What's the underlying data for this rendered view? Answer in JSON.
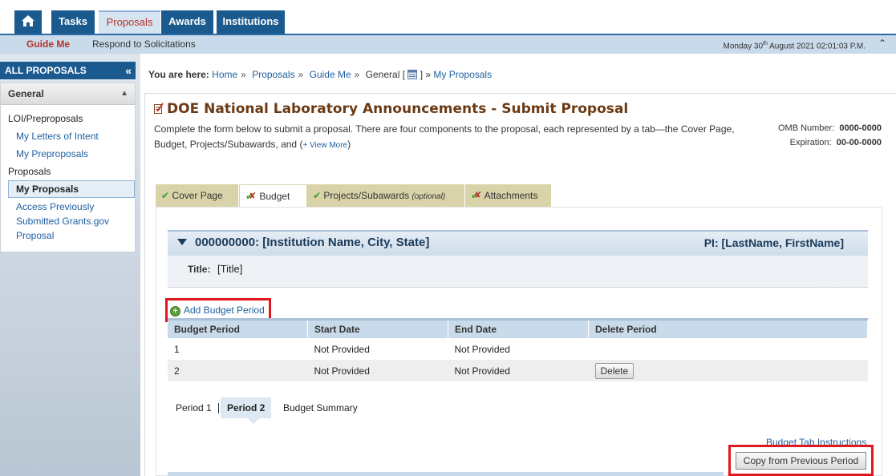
{
  "nav": {
    "tabs": [
      {
        "label": "Tasks"
      },
      {
        "label": "Proposals"
      },
      {
        "label": "Awards"
      },
      {
        "label": "Institutions"
      }
    ],
    "subnav": {
      "guide": "Guide Me",
      "respond": "Respond to Solicitations"
    },
    "datetime": {
      "day": "Monday 30",
      "sup": "th",
      "rest": " August 2021 02:01:03 P.M."
    }
  },
  "sidebar": {
    "header": "ALL PROPOSALS",
    "section": "General",
    "groups": [
      {
        "label": "LOI/Preproposals",
        "items": [
          "My Letters of Intent",
          "My Preproposals"
        ]
      },
      {
        "label": "Proposals",
        "items": [
          "My Proposals",
          "Access Previously Submitted Grants.gov Proposal"
        ]
      }
    ]
  },
  "breadcrumb": {
    "prefix": "You are here:",
    "items": [
      "Home",
      "Proposals",
      "Guide Me",
      "General [",
      "] »",
      "My Proposals"
    ]
  },
  "page": {
    "title": "DOE National Laboratory Announcements - Submit Proposal",
    "intro": "Complete the form below to submit a proposal. There are four components to the proposal, each represented by a tab—the Cover Page, Budget, Projects/Subawards, and (",
    "view_more": "+ View More",
    "intro_end": ")",
    "omb_label": "OMB Number:",
    "omb_value": "0000-0000",
    "exp_label": "Expiration:",
    "exp_value": "00-00-0000"
  },
  "tabs": [
    {
      "label": "Cover Page",
      "status": "complete"
    },
    {
      "label": "Budget",
      "status": "incomplete",
      "active": true
    },
    {
      "label": "Projects/Subawards",
      "optional": "(optional)",
      "status": "complete"
    },
    {
      "label": "Attachments",
      "status": "incomplete"
    }
  ],
  "institution": {
    "name": "000000000: [Institution Name, City, State]",
    "pi": "PI: [LastName, FirstName]",
    "title_label": "Title:",
    "title_value": "[Title]"
  },
  "budget": {
    "add_label": "Add Budget Period",
    "columns": [
      "Budget Period",
      "Start Date",
      "End Date",
      "Delete Period"
    ],
    "rows": [
      {
        "period": "1",
        "start": "Not Provided",
        "end": "Not Provided",
        "delete": ""
      },
      {
        "period": "2",
        "start": "Not Provided",
        "end": "Not Provided",
        "delete": "Delete"
      }
    ],
    "period_tabs": [
      "Period 1",
      "Period 2",
      "Budget Summary"
    ],
    "instructions": "Budget Tab Instructions",
    "copy_label": "Copy from Previous Period"
  },
  "colors": {
    "nav_blue": "#1b5a8f",
    "highlight_red": "#e0191f",
    "tab_khaki": "#d9d3a9",
    "title_brown": "#6b3a14"
  }
}
